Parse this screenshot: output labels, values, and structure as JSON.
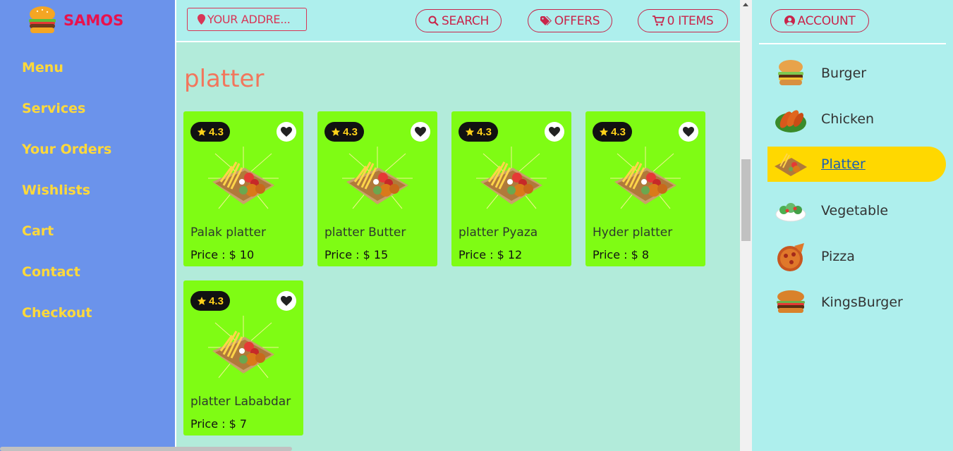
{
  "brand": {
    "name": "SAMOS",
    "logo_icon": "burger-icon"
  },
  "sidebar": {
    "items": [
      {
        "label": "Menu"
      },
      {
        "label": "Services"
      },
      {
        "label": "Your Orders"
      },
      {
        "label": "Wishlists"
      },
      {
        "label": "Cart"
      },
      {
        "label": "Contact"
      },
      {
        "label": "Checkout"
      }
    ]
  },
  "topbar": {
    "address_placeholder": "YOUR ADDRE...",
    "search_label": "SEARCH",
    "offers_label": "OFFERS",
    "cart_label": "0 ITEMS"
  },
  "content": {
    "title": "platter",
    "products": [
      {
        "rating": "4.3",
        "name": "Palak platter",
        "price": "Price : $ 10"
      },
      {
        "rating": "4.3",
        "name": "platter Butter",
        "price": "Price : $ 15"
      },
      {
        "rating": "4.3",
        "name": "platter Pyaza",
        "price": "Price : $ 12"
      },
      {
        "rating": "4.3",
        "name": "Hyder platter",
        "price": "Price : $ 8"
      },
      {
        "rating": "4.3",
        "name": "platter Lababdar",
        "price": "Price : $ 7"
      }
    ]
  },
  "right_panel": {
    "account_label": "ACCOUNT",
    "categories": [
      {
        "label": "Burger",
        "icon": "burger-icon"
      },
      {
        "label": "Chicken",
        "icon": "chicken-icon"
      },
      {
        "label": "Platter",
        "icon": "platter-icon",
        "active": true
      },
      {
        "label": "Vegetable",
        "icon": "salad-icon"
      },
      {
        "label": "Pizza",
        "icon": "pizza-icon"
      },
      {
        "label": "KingsBurger",
        "icon": "burger-icon"
      }
    ]
  },
  "colors": {
    "sidebar_bg": "#6b93eb",
    "sidebar_text": "#ffd93a",
    "brand": "#e8124d",
    "card_bg": "#7ffc14",
    "active_category": "#ffd800",
    "accent": "#c9244a"
  }
}
